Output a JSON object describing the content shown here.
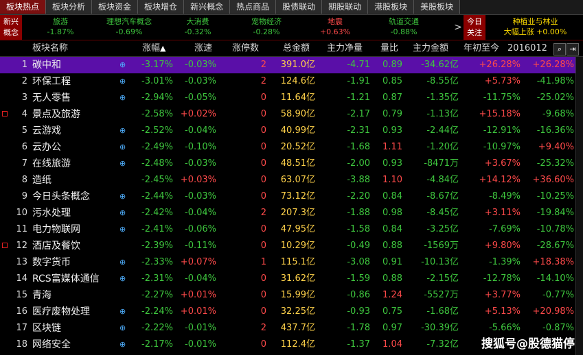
{
  "tabs": [
    "板块热点",
    "板块分析",
    "板块资金",
    "板块增仓",
    "新兴概念",
    "热点商品",
    "股债联动",
    "期股联动",
    "港股板块",
    "美股板块"
  ],
  "strip": {
    "left_tag": "新兴\n概念",
    "sectors": [
      {
        "name": "旅游",
        "change": "-1.87%",
        "up": false
      },
      {
        "name": "理想汽车概念",
        "change": "-0.69%",
        "up": false
      },
      {
        "name": "大消费",
        "change": "-0.32%",
        "up": false
      },
      {
        "name": "宠物经济",
        "change": "-0.28%",
        "up": false
      },
      {
        "name": "地震",
        "change": "+0.63%",
        "up": true
      },
      {
        "name": "轨道交通",
        "change": "-0.88%",
        "up": false
      }
    ],
    "nav_arrow": ">",
    "right_tag": "今日\n关注",
    "hot_name": "种植业与林业",
    "hot_change": "大幅上涨 +0.00%"
  },
  "header": {
    "name": "板块名称",
    "change": "涨幅",
    "speed": "涨速",
    "limit_up": "涨停数",
    "amount": "总金额",
    "net": "主力净量",
    "vol_ratio": "量比",
    "main_amount": "主力金额",
    "ytd": "年初至今",
    "date": "2016012"
  },
  "rows": [
    {
      "idx": "1",
      "name": "碳中和",
      "plus": true,
      "marker": false,
      "chg": "-3.17%",
      "spd": "-0.03%",
      "lim": "2",
      "amt": "391.0亿",
      "net": "-4.71",
      "vr": "0.89",
      "mamt": "-34.62亿",
      "ytd": "+26.28%",
      "last": "+26.28%"
    },
    {
      "idx": "2",
      "name": "环保工程",
      "plus": true,
      "marker": false,
      "chg": "-3.01%",
      "spd": "-0.03%",
      "lim": "2",
      "amt": "124.6亿",
      "net": "-1.91",
      "vr": "0.85",
      "mamt": "-8.55亿",
      "ytd": "+5.73%",
      "last": "-41.98%"
    },
    {
      "idx": "3",
      "name": "无人零售",
      "plus": true,
      "marker": false,
      "chg": "-2.94%",
      "spd": "-0.05%",
      "lim": "0",
      "amt": "11.64亿",
      "net": "-1.21",
      "vr": "0.87",
      "mamt": "-1.35亿",
      "ytd": "-11.75%",
      "last": "-25.02%"
    },
    {
      "idx": "4",
      "name": "景点及旅游",
      "plus": false,
      "marker": true,
      "chg": "-2.58%",
      "spd": "+0.02%",
      "lim": "0",
      "amt": "58.90亿",
      "net": "-2.17",
      "vr": "0.79",
      "mamt": "-1.13亿",
      "ytd": "+15.18%",
      "last": "-9.68%"
    },
    {
      "idx": "5",
      "name": "云游戏",
      "plus": true,
      "marker": false,
      "chg": "-2.52%",
      "spd": "-0.04%",
      "lim": "0",
      "amt": "40.99亿",
      "net": "-2.31",
      "vr": "0.93",
      "mamt": "-2.44亿",
      "ytd": "-12.91%",
      "last": "-16.36%"
    },
    {
      "idx": "6",
      "name": "云办公",
      "plus": true,
      "marker": false,
      "chg": "-2.49%",
      "spd": "-0.10%",
      "lim": "0",
      "amt": "20.52亿",
      "net": "-1.68",
      "vr": "1.11",
      "mamt": "-1.20亿",
      "ytd": "-10.97%",
      "last": "+9.40%"
    },
    {
      "idx": "7",
      "name": "在线旅游",
      "plus": true,
      "marker": false,
      "chg": "-2.48%",
      "spd": "-0.03%",
      "lim": "0",
      "amt": "48.51亿",
      "net": "-2.00",
      "vr": "0.93",
      "mamt": "-8471万",
      "ytd": "+3.67%",
      "last": "-25.32%"
    },
    {
      "idx": "8",
      "name": "造纸",
      "plus": false,
      "marker": false,
      "chg": "-2.45%",
      "spd": "+0.03%",
      "lim": "0",
      "amt": "63.07亿",
      "net": "-3.88",
      "vr": "1.10",
      "mamt": "-4.84亿",
      "ytd": "+14.12%",
      "last": "+36.60%"
    },
    {
      "idx": "9",
      "name": "今日头条概念",
      "plus": true,
      "marker": false,
      "chg": "-2.44%",
      "spd": "-0.03%",
      "lim": "0",
      "amt": "73.12亿",
      "net": "-2.20",
      "vr": "0.84",
      "mamt": "-8.67亿",
      "ytd": "-8.49%",
      "last": "-10.25%"
    },
    {
      "idx": "10",
      "name": "污水处理",
      "plus": true,
      "marker": false,
      "chg": "-2.42%",
      "spd": "-0.04%",
      "lim": "2",
      "amt": "207.3亿",
      "net": "-1.88",
      "vr": "0.98",
      "mamt": "-8.45亿",
      "ytd": "+3.11%",
      "last": "-19.84%"
    },
    {
      "idx": "11",
      "name": "电力物联网",
      "plus": true,
      "marker": false,
      "chg": "-2.41%",
      "spd": "-0.06%",
      "lim": "0",
      "amt": "47.95亿",
      "net": "-1.58",
      "vr": "0.84",
      "mamt": "-3.25亿",
      "ytd": "-7.69%",
      "last": "-10.78%"
    },
    {
      "idx": "12",
      "name": "酒店及餐饮",
      "plus": false,
      "marker": true,
      "chg": "-2.39%",
      "spd": "-0.11%",
      "lim": "0",
      "amt": "10.29亿",
      "net": "-0.49",
      "vr": "0.88",
      "mamt": "-1569万",
      "ytd": "+9.80%",
      "last": "-28.67%"
    },
    {
      "idx": "13",
      "name": "数字货币",
      "plus": true,
      "marker": false,
      "chg": "-2.33%",
      "spd": "+0.07%",
      "lim": "1",
      "amt": "115.1亿",
      "net": "-3.08",
      "vr": "0.91",
      "mamt": "-10.13亿",
      "ytd": "-1.39%",
      "last": "+18.38%"
    },
    {
      "idx": "14",
      "name": "RCS富媒体通信",
      "plus": true,
      "marker": false,
      "chg": "-2.31%",
      "spd": "-0.04%",
      "lim": "0",
      "amt": "31.62亿",
      "net": "-1.59",
      "vr": "0.88",
      "mamt": "-2.15亿",
      "ytd": "-12.78%",
      "last": "-14.10%"
    },
    {
      "idx": "15",
      "name": "青海",
      "plus": false,
      "marker": false,
      "chg": "-2.27%",
      "spd": "+0.01%",
      "lim": "0",
      "amt": "15.99亿",
      "net": "-0.86",
      "vr": "1.24",
      "mamt": "-5527万",
      "ytd": "+3.77%",
      "last": "-0.77%"
    },
    {
      "idx": "16",
      "name": "医疗废物处理",
      "plus": true,
      "marker": false,
      "chg": "-2.24%",
      "spd": "+0.01%",
      "lim": "0",
      "amt": "32.25亿",
      "net": "-0.93",
      "vr": "0.75",
      "mamt": "-1.68亿",
      "ytd": "+5.13%",
      "last": "+20.98%"
    },
    {
      "idx": "17",
      "name": "区块链",
      "plus": true,
      "marker": false,
      "chg": "-2.22%",
      "spd": "-0.01%",
      "lim": "2",
      "amt": "437.7亿",
      "net": "-1.78",
      "vr": "0.97",
      "mamt": "-30.39亿",
      "ytd": "-5.66%",
      "last": "-0.87%"
    },
    {
      "idx": "18",
      "name": "网络安全",
      "plus": true,
      "marker": false,
      "chg": "-2.17%",
      "spd": "-0.01%",
      "lim": "0",
      "amt": "112.4亿",
      "net": "-1.37",
      "vr": "1.04",
      "mamt": "-7.32亿",
      "ytd": "",
      "last": ""
    }
  ],
  "watermark": "搜狐号@股德猫停",
  "colors": {
    "up": "#ff4a4a",
    "down": "#3ec63e",
    "amount": "#ffd24a",
    "selected_row": "#5a0fa8",
    "active_tab": "#7a1010"
  },
  "icons": {
    "sort": "sort-up-arrow-icon",
    "search": "search-icon",
    "export": "export-icon",
    "plus": "add-icon",
    "marker": "marker-icon"
  }
}
